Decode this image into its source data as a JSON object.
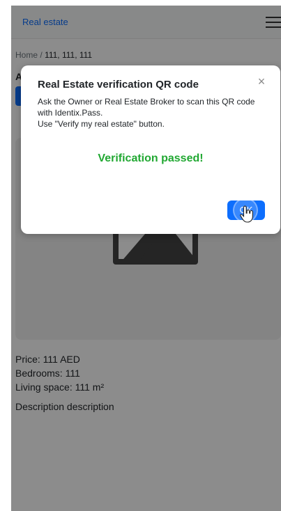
{
  "navbar": {
    "brand": "Real estate",
    "menu_icon": "hamburger-menu-icon"
  },
  "breadcrumb": {
    "home": "Home",
    "separator": "/",
    "current": "111, 111, 111"
  },
  "listing": {
    "title_initial": "A",
    "price": "Price: 111 AED",
    "bedrooms": "Bedrooms: 111",
    "living_space": "Living space: 111 m²",
    "description": "Description description",
    "image_icon": "image-placeholder-icon"
  },
  "modal": {
    "title": "Real Estate verification QR code",
    "close_icon": "close-icon",
    "body_line1": "Ask the Owner or Real Estate Broker to scan this QR code with Identix.Pass.",
    "body_line2": "Use \"Verify my real estate\" button.",
    "status": "Verification passed!",
    "ok_label": "OK",
    "status_color": "#21a832",
    "accent_color": "#0d6efd"
  },
  "cursor": {
    "icon": "hand-pointer-icon"
  }
}
